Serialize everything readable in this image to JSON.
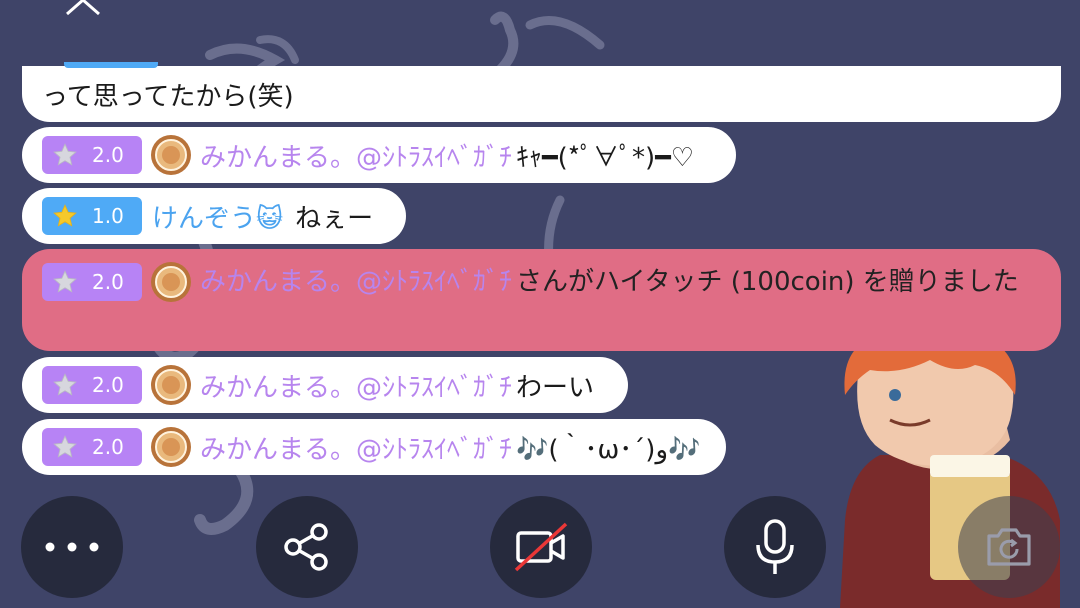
{
  "messages": [
    {
      "type": "continued",
      "text": "って思ってたから(笑)"
    },
    {
      "type": "chat",
      "level": "2.0",
      "badge_color": "#b783f5",
      "has_coin": true,
      "user": "みかんまる。@ｼﾄﾗｽｲﾍﾞｶﾞﾁ",
      "user_color": "#b785ee",
      "text": "ｷｬ━(*ﾟ∀ﾟ*)━♡"
    },
    {
      "type": "chat",
      "level": "1.0",
      "badge_color": "#4faaf6",
      "has_coin": false,
      "user": "けんぞう😺",
      "user_color": "#4ba3ef",
      "text": "ねぇー"
    },
    {
      "type": "gift",
      "level": "2.0",
      "badge_color": "#b783f5",
      "has_coin": true,
      "user": "みかんまる。@ｼﾄﾗｽｲﾍﾞｶﾞﾁ",
      "user_color": "#b785ee",
      "text": "さんがハイタッチ (100coin) を贈りました",
      "bg_color": "#e06d85"
    },
    {
      "type": "chat",
      "level": "2.0",
      "badge_color": "#b783f5",
      "has_coin": true,
      "user": "みかんまる。@ｼﾄﾗｽｲﾍﾞｶﾞﾁ",
      "user_color": "#b785ee",
      "text": "わーい"
    },
    {
      "type": "chat",
      "level": "2.0",
      "badge_color": "#b783f5",
      "has_coin": true,
      "user": "みかんまる。@ｼﾄﾗｽｲﾍﾞｶﾞﾁ",
      "user_color": "#b785ee",
      "text": "🎶(｀･ω･´)و🎶"
    }
  ],
  "toolbar": {
    "icons": [
      "more-icon",
      "share-icon",
      "camera-off-icon",
      "microphone-icon",
      "camera-switch-icon"
    ]
  },
  "colors": {
    "background": "#3f4468",
    "button": "#262a3d"
  }
}
